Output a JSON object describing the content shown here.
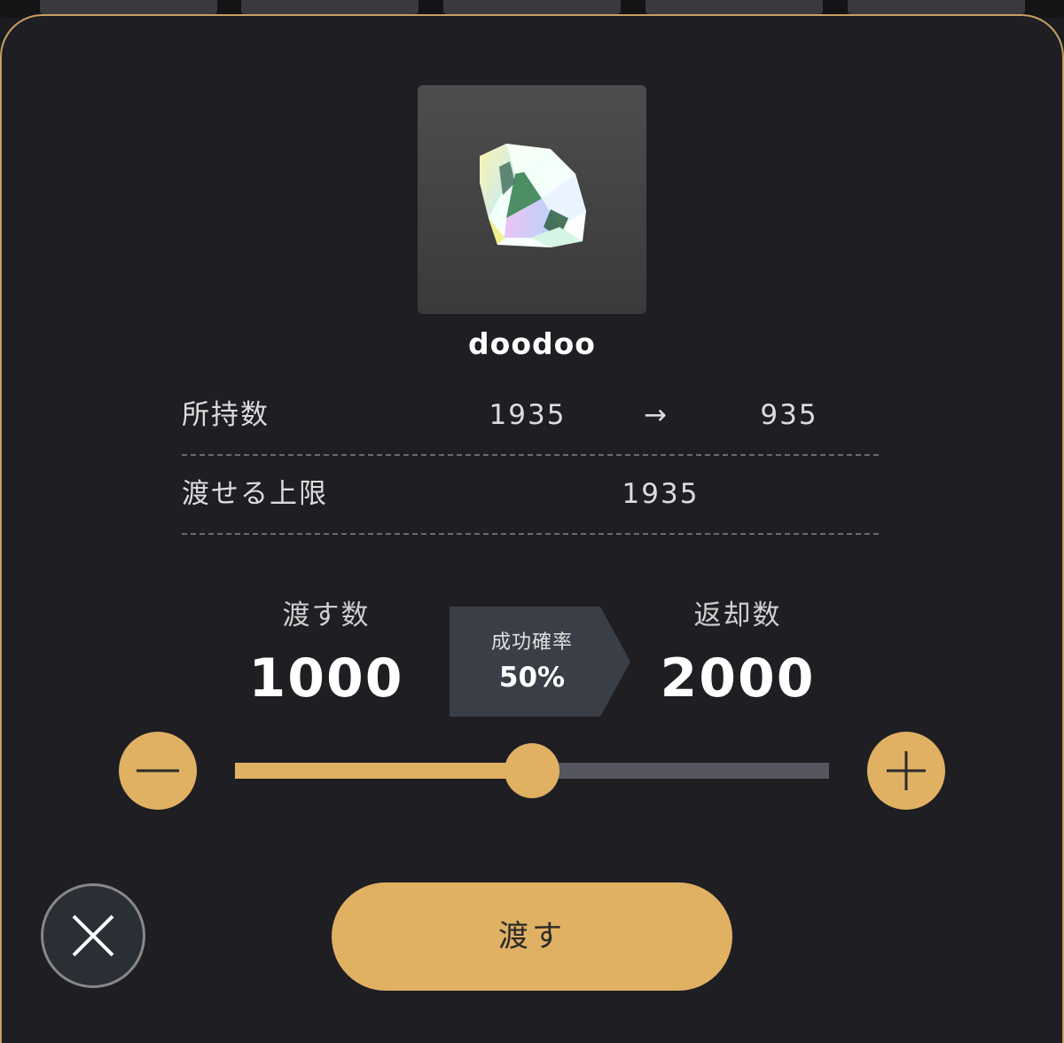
{
  "item": {
    "name": "doodoo",
    "icon": "diamond-icon"
  },
  "holdings": {
    "label": "所持数",
    "current": "1935",
    "arrow": "→",
    "after": "935"
  },
  "limit": {
    "label": "渡せる上限",
    "value": "1935"
  },
  "give": {
    "label": "渡す数",
    "value": "1000"
  },
  "success_rate": {
    "label": "成功確率",
    "value": "50%"
  },
  "return": {
    "label": "返却数",
    "value": "2000"
  },
  "slider": {
    "fraction": 0.5
  },
  "actions": {
    "submit_label": "渡す",
    "close_icon": "close-icon",
    "minus_icon": "minus-icon",
    "plus_icon": "plus-icon"
  },
  "colors": {
    "accent": "#e0b163",
    "panel": "#1e1e23",
    "track": "#55565f"
  }
}
